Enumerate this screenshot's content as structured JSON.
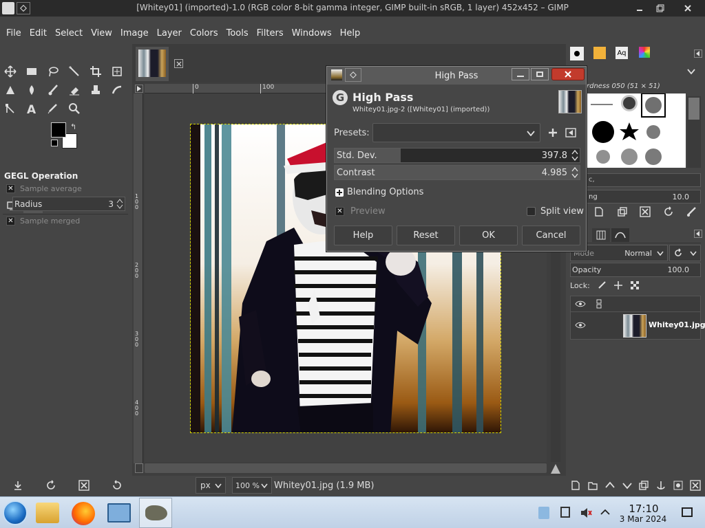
{
  "window": {
    "title": "[Whitey01] (imported)-1.0 (RGB color 8-bit gamma integer, GIMP built-in sRGB, 1 layer) 452x452 – GIMP"
  },
  "menu": [
    "File",
    "Edit",
    "Select",
    "View",
    "Image",
    "Layer",
    "Colors",
    "Tools",
    "Filters",
    "Windows",
    "Help"
  ],
  "tool_options": {
    "title": "GEGL Operation",
    "sample_average": "Sample average",
    "radius_label": "Radius",
    "radius_value": "3",
    "sample_merged": "Sample merged"
  },
  "ruler": {
    "top_ticks": [
      "0",
      "100"
    ],
    "left_ticks": [
      "1\n0\n0",
      "2\n0\n0",
      "3\n0\n0",
      "4\n0\n0"
    ]
  },
  "status": {
    "unit": "px",
    "zoom": "100 %",
    "file": "Whitey01.jpg (1.9 MB)"
  },
  "dialog": {
    "window_title": "High Pass",
    "heading": "High Pass",
    "subheading": "Whitey01.jpg-2 ([Whitey01] (imported))",
    "presets_label": "Presets:",
    "std_dev_label": "Std. Dev.",
    "std_dev_value": "397.8",
    "std_dev_fraction": 0.27,
    "contrast_label": "Contrast",
    "contrast_value": "4.985",
    "blending_options": "Blending Options",
    "preview": "Preview",
    "split_view": "Split view",
    "buttons": {
      "help": "Help",
      "reset": "Reset",
      "ok": "OK",
      "cancel": "Cancel"
    }
  },
  "brushes": {
    "title": "rdness 050 (51 × 51)",
    "spacing_label": "ng",
    "spacing_value": "10.0",
    "tag_text": "c,"
  },
  "layers": {
    "mode_label": "Mode",
    "mode_value": "Normal",
    "opacity_label": "Opacity",
    "opacity_value": "100.0",
    "lock_label": "Lock:",
    "layer_name": "Whitey01.jpg"
  },
  "taskbar": {
    "time": "17:10",
    "date": "3 Mar 2024"
  },
  "colors": {
    "accent_red": "#c8102e",
    "dialog_bg": "#464646"
  }
}
